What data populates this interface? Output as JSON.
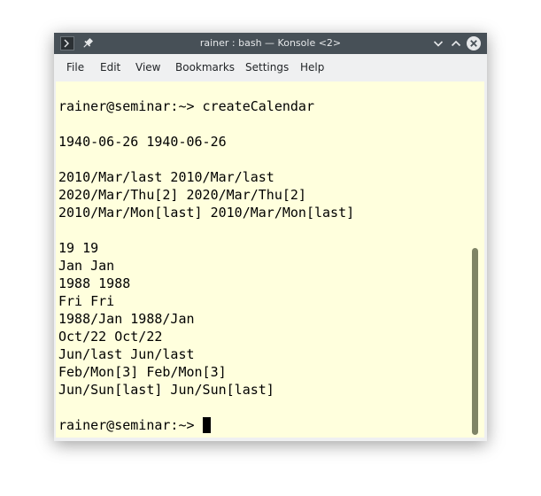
{
  "window": {
    "title": "rainer : bash — Konsole <2>"
  },
  "menubar": {
    "items": [
      "File",
      "Edit",
      "View",
      "Bookmarks",
      "Settings",
      "Help"
    ]
  },
  "terminal": {
    "lines": [
      "rainer@seminar:~> createCalendar",
      "",
      "1940-06-26 1940-06-26",
      "",
      "2010/Mar/last 2010/Mar/last",
      "2020/Mar/Thu[2] 2020/Mar/Thu[2]",
      "2010/Mar/Mon[last] 2010/Mar/Mon[last]",
      "",
      "19 19",
      "Jan Jan",
      "1988 1988",
      "Fri Fri",
      "1988/Jan 1988/Jan",
      "Oct/22 Oct/22",
      "Jun/last Jun/last",
      "Feb/Mon[3] Feb/Mon[3]",
      "Jun/Sun[last] Jun/Sun[last]",
      ""
    ],
    "prompt": "rainer@seminar:~> "
  },
  "colors": {
    "titlebar": "#475057",
    "terminal_background": "#ffffdd",
    "scrollbar": "#7f8466"
  },
  "icons": [
    "konsole-app-icon",
    "pin-icon",
    "minimize-icon",
    "maximize-icon",
    "close-icon",
    "cursor"
  ]
}
